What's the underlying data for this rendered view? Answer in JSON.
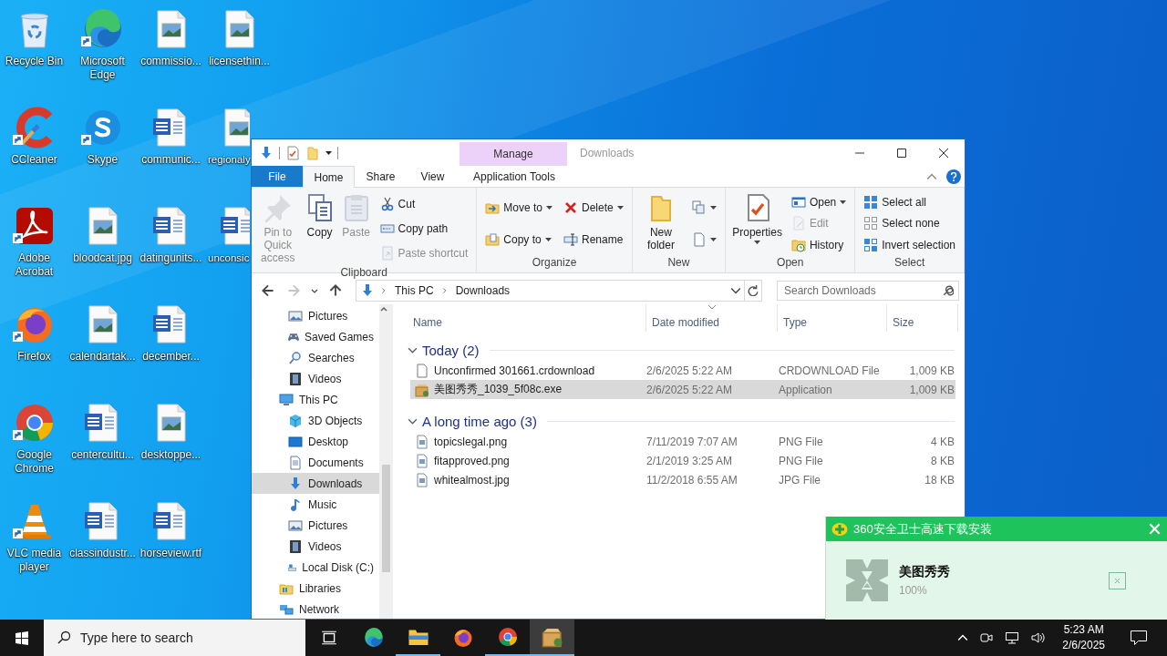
{
  "desktop": {
    "rows": [
      [
        {
          "label": "Recycle Bin",
          "kind": "recycle",
          "shortcut": false,
          "covered": false
        },
        {
          "label": "Microsoft Edge",
          "kind": "edge",
          "shortcut": true,
          "covered": false
        },
        {
          "label": "commissio...",
          "kind": "image",
          "shortcut": false,
          "covered": false
        },
        {
          "label": "licensethin...",
          "kind": "image",
          "shortcut": false,
          "covered": false
        }
      ],
      [
        {
          "label": "CCleaner",
          "kind": "ccleaner",
          "shortcut": true,
          "covered": false
        },
        {
          "label": "Skype",
          "kind": "skype",
          "shortcut": true,
          "covered": false
        },
        {
          "label": "communic...",
          "kind": "word",
          "shortcut": false,
          "covered": false
        },
        {
          "label": "regionaly",
          "kind": "image",
          "shortcut": false,
          "covered": true
        }
      ],
      [
        {
          "label": "Adobe Acrobat",
          "kind": "acrobat",
          "shortcut": true,
          "covered": false
        },
        {
          "label": "bloodcat.jpg",
          "kind": "image",
          "shortcut": false,
          "covered": false
        },
        {
          "label": "datingunits...",
          "kind": "word",
          "shortcut": false,
          "covered": false
        },
        {
          "label": "unconsic",
          "kind": "word",
          "shortcut": false,
          "covered": true
        }
      ],
      [
        {
          "label": "Firefox",
          "kind": "firefox",
          "shortcut": true,
          "covered": false
        },
        {
          "label": "calendartak...",
          "kind": "image",
          "shortcut": false,
          "covered": false
        },
        {
          "label": "december...",
          "kind": "word",
          "shortcut": false,
          "covered": false
        }
      ],
      [
        {
          "label": "Google Chrome",
          "kind": "chrome",
          "shortcut": true,
          "covered": false
        },
        {
          "label": "centercultu...",
          "kind": "word",
          "shortcut": false,
          "covered": false
        },
        {
          "label": "desktoppe...",
          "kind": "image",
          "shortcut": false,
          "covered": false
        }
      ],
      [
        {
          "label": "VLC media player",
          "kind": "vlc",
          "shortcut": true,
          "covered": false
        },
        {
          "label": "classindustr...",
          "kind": "word",
          "shortcut": false,
          "covered": false
        },
        {
          "label": "horseview.rtf",
          "kind": "word",
          "shortcut": false,
          "covered": false
        }
      ]
    ]
  },
  "explorer": {
    "context_label": "Manage",
    "title": "Downloads",
    "tabs": [
      {
        "label": "File",
        "kind": "file",
        "selected": false
      },
      {
        "label": "Home",
        "kind": "normal",
        "selected": true
      },
      {
        "label": "Share",
        "kind": "normal",
        "selected": false
      },
      {
        "label": "View",
        "kind": "normal",
        "selected": false
      },
      {
        "label": "Application Tools",
        "kind": "contextual",
        "selected": false
      }
    ],
    "ribbon": {
      "groups": [
        {
          "label": "Clipboard",
          "columns": [
            {
              "kind": "large",
              "items": [
                {
                  "label": "Pin to Quick access",
                  "kind": "pin",
                  "disabled": true,
                  "dropdown": false
                }
              ]
            },
            {
              "kind": "large",
              "items": [
                {
                  "label": "Copy",
                  "kind": "copy",
                  "disabled": false,
                  "dropdown": false
                }
              ]
            },
            {
              "kind": "large",
              "items": [
                {
                  "label": "Paste",
                  "kind": "paste",
                  "disabled": true,
                  "dropdown": false
                }
              ]
            },
            {
              "kind": "small",
              "items": [
                {
                  "label": "Cut",
                  "kind": "cut",
                  "disabled": false,
                  "dropdown": false
                },
                {
                  "label": "Copy path",
                  "kind": "copypath",
                  "disabled": false,
                  "dropdown": false
                },
                {
                  "label": "Paste shortcut",
                  "kind": "pasteshortcut",
                  "disabled": true,
                  "dropdown": false
                }
              ]
            }
          ]
        },
        {
          "label": "Organize",
          "columns": [
            {
              "kind": "small",
              "items": [
                {
                  "label": "Move to",
                  "kind": "moveto",
                  "disabled": false,
                  "dropdown": true
                },
                {
                  "label": "Copy to",
                  "kind": "copyto",
                  "disabled": false,
                  "dropdown": true
                }
              ]
            },
            {
              "kind": "small",
              "items": [
                {
                  "label": "Delete",
                  "kind": "delete",
                  "disabled": false,
                  "dropdown": true
                },
                {
                  "label": "Rename",
                  "kind": "rename",
                  "disabled": false,
                  "dropdown": false
                }
              ]
            }
          ]
        },
        {
          "label": "New",
          "columns": [
            {
              "kind": "large",
              "items": [
                {
                  "label": "New folder",
                  "kind": "newfolder",
                  "disabled": false,
                  "dropdown": false
                }
              ]
            },
            {
              "kind": "small",
              "items": [
                {
                  "kind": "newitem",
                  "disabled": false,
                  "dropdown": true
                },
                {
                  "kind": "easyaccess",
                  "disabled": false,
                  "dropdown": true
                }
              ]
            }
          ]
        },
        {
          "label": "Open",
          "columns": [
            {
              "kind": "large",
              "items": [
                {
                  "label": "Properties",
                  "kind": "properties",
                  "disabled": false,
                  "dropdown": true
                }
              ]
            },
            {
              "kind": "small",
              "items": [
                {
                  "label": "Open",
                  "kind": "open",
                  "disabled": false,
                  "dropdown": true
                },
                {
                  "label": "Edit",
                  "kind": "edit",
                  "disabled": true,
                  "dropdown": false
                },
                {
                  "label": "History",
                  "kind": "history",
                  "disabled": false,
                  "dropdown": false
                }
              ]
            }
          ]
        },
        {
          "label": "Select",
          "columns": [
            {
              "kind": "small",
              "items": [
                {
                  "label": "Select all",
                  "kind": "selectall",
                  "disabled": false,
                  "dropdown": false
                },
                {
                  "label": "Select none",
                  "kind": "selectnone",
                  "disabled": false,
                  "dropdown": false
                },
                {
                  "label": "Invert selection",
                  "kind": "invert",
                  "disabled": false,
                  "dropdown": false
                }
              ]
            }
          ]
        }
      ]
    },
    "nav_buttons": [
      {
        "kind": "back",
        "disabled": false
      },
      {
        "kind": "forward",
        "disabled": true
      },
      {
        "kind": "recent",
        "disabled": false
      },
      {
        "kind": "up",
        "disabled": false
      }
    ],
    "address": {
      "path": [
        "This PC",
        "Downloads"
      ]
    },
    "search": {
      "placeholder": "Search Downloads"
    },
    "navigation": {
      "continued_items": [
        {
          "label": "Pictures",
          "kind": "pictures",
          "selected": false
        },
        {
          "label": "Saved Games",
          "kind": "games",
          "selected": false
        },
        {
          "label": "Searches",
          "kind": "search",
          "selected": false
        },
        {
          "label": "Videos",
          "kind": "videos",
          "selected": false
        }
      ],
      "items": [
        {
          "label": "This PC",
          "kind": "pc",
          "selected": false,
          "children": [
            {
              "label": "3D Objects",
              "kind": "cube",
              "selected": false
            },
            {
              "label": "Desktop",
              "kind": "desktop",
              "selected": false
            },
            {
              "label": "Documents",
              "kind": "documents",
              "selected": false
            },
            {
              "label": "Downloads",
              "kind": "downloads",
              "selected": true
            },
            {
              "label": "Music",
              "kind": "music",
              "selected": false
            },
            {
              "label": "Pictures",
              "kind": "pictures",
              "selected": false
            },
            {
              "label": "Videos",
              "kind": "videos",
              "selected": false
            },
            {
              "label": "Local Disk (C:)",
              "kind": "disk",
              "selected": false
            }
          ]
        },
        {
          "label": "Libraries",
          "kind": "libraries",
          "selected": false
        },
        {
          "label": "Network",
          "kind": "network",
          "selected": false
        }
      ]
    },
    "file_list": {
      "columns": [
        {
          "label": "Name",
          "sorted": false
        },
        {
          "label": "Date modified",
          "sorted": true
        },
        {
          "label": "Type",
          "sorted": false
        },
        {
          "label": "Size",
          "sorted": false
        }
      ],
      "groups": [
        {
          "title": "Today (2)",
          "expanded": true,
          "files": [
            {
              "name": "Unconfirmed 301661.crdownload",
              "date": "2/6/2025 5:22 AM",
              "type": "CRDOWNLOAD File",
              "size": "1,009 KB",
              "kind": "blank",
              "selected": false
            },
            {
              "name": "美图秀秀_1039_5f08c.exe",
              "date": "2/6/2025 5:22 AM",
              "type": "Application",
              "size": "1,009 KB",
              "kind": "package",
              "selected": true
            }
          ]
        },
        {
          "title": "A long time ago (3)",
          "expanded": true,
          "files": [
            {
              "name": "topicslegal.png",
              "date": "7/11/2019 7:07 AM",
              "type": "PNG File",
              "size": "4 KB",
              "kind": "image",
              "selected": false
            },
            {
              "name": "fitapproved.png",
              "date": "2/1/2019 3:25 AM",
              "type": "PNG File",
              "size": "8 KB",
              "kind": "image",
              "selected": false
            },
            {
              "name": "whitealmost.jpg",
              "date": "11/2/2018 6:55 AM",
              "type": "JPG File",
              "size": "18 KB",
              "kind": "image",
              "selected": false
            }
          ]
        }
      ]
    }
  },
  "popup": {
    "title": "360安全卫士高速下载安装",
    "app_name": "美图秀秀",
    "progress": "100%"
  },
  "taskbar": {
    "search_placeholder": "Type here to search",
    "apps": [
      {
        "kind": "taskview",
        "running": false,
        "selected": false
      },
      {
        "kind": "edge",
        "running": false,
        "selected": false
      },
      {
        "kind": "explorer",
        "running": true,
        "selected": false
      },
      {
        "kind": "firefox",
        "running": false,
        "selected": false
      },
      {
        "kind": "chrome",
        "running": true,
        "selected": false
      },
      {
        "kind": "package",
        "running": true,
        "selected": true
      }
    ],
    "time": "5:23 AM",
    "date": "2/6/2025"
  }
}
